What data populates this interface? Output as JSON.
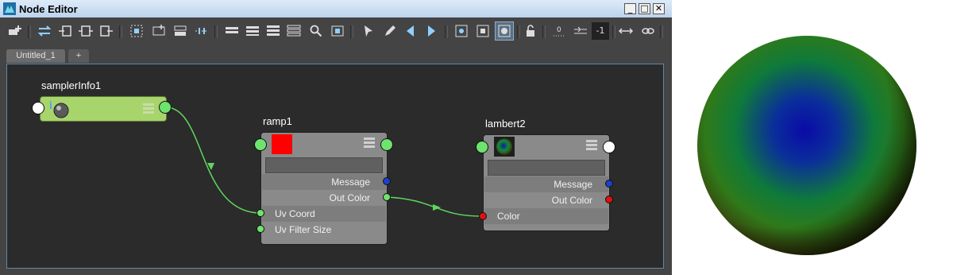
{
  "window": {
    "title": "Node Editor"
  },
  "title_buttons": {
    "minimize": "_",
    "maximize": "□",
    "close": "✕"
  },
  "toolbar": {
    "icons": [
      "add-node-icon",
      "swap-icon",
      "input-connections-icon",
      "input-output-connections-icon",
      "output-connections-icon",
      "frame-all-icon",
      "frame-selected-icon",
      "layout-icon",
      "align-icon",
      "hide-attributes-icon",
      "show-connected-icon",
      "show-all-icon",
      "show-custom-icon",
      "search-icon",
      "graph-icon",
      "pin-icon",
      "edit-icon",
      "select-upstream-icon",
      "select-downstream-icon",
      "map-icon",
      "bookmark-icon",
      "swatch-icon",
      "lock-icon",
      "grid-icon",
      "connect-icon"
    ],
    "counter_label": "-1"
  },
  "tabs": {
    "active": "Untitled_1",
    "add": "+"
  },
  "nodes": {
    "sampler": {
      "name": "samplerInfo1"
    },
    "ramp": {
      "name": "ramp1",
      "swatch_color": "#ff0000",
      "rows": [
        "Message",
        "Out Color",
        "Uv Coord",
        "Uv Filter Size"
      ]
    },
    "lambert": {
      "name": "lambert2",
      "rows": [
        "Message",
        "Out Color",
        "Color"
      ]
    }
  },
  "colors": {
    "port_green": "#6ee36e",
    "port_blue": "#1f3fc8",
    "port_red": "#e01010",
    "wire": "#5ed65e",
    "sampler_body": "#a8d46c"
  }
}
